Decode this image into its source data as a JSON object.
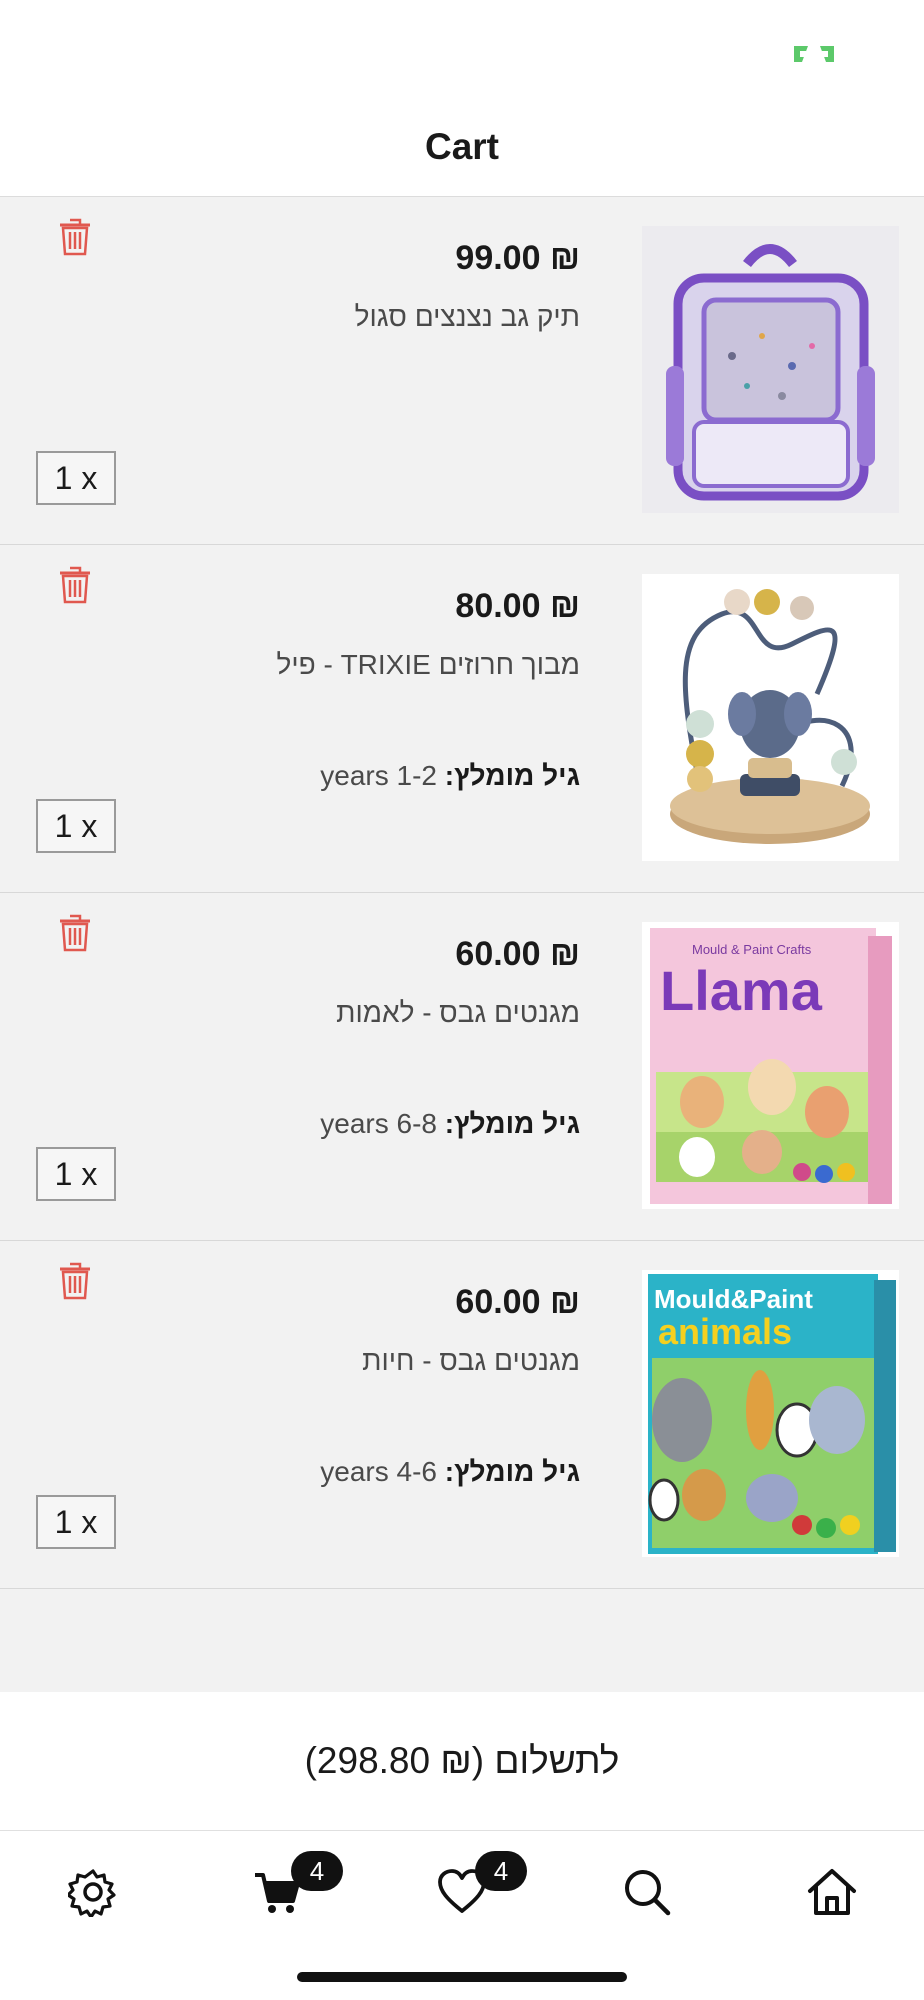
{
  "header": {
    "title": "Cart"
  },
  "cart": {
    "items": [
      {
        "price": "₪ 99.00",
        "name": "תיק גב נצנצים סגול",
        "age_label": "",
        "age_value": "",
        "quantity": "1 x",
        "image_icon": "purple-backpack-image"
      },
      {
        "price": "₪ 80.00",
        "name": "מבוך חרוזים TRIXIE - פיל",
        "age_label": "גיל מומלץ:",
        "age_value": "1-2 years",
        "quantity": "1 x",
        "image_icon": "bead-maze-elephant-image"
      },
      {
        "price": "₪ 60.00",
        "name": "מגנטים גבס - לאמות",
        "age_label": "גיל מומלץ:",
        "age_value": "6-8 years",
        "quantity": "1 x",
        "image_icon": "llama-craft-box-image",
        "image_text": {
          "brand": "Mould & Paint Crafts",
          "title": "Llama"
        }
      },
      {
        "price": "₪ 60.00",
        "name": "מגנטים גבס - חיות",
        "age_label": "גיל מומלץ:",
        "age_value": "4-6 years",
        "quantity": "1 x",
        "image_icon": "animals-craft-box-image",
        "image_text": {
          "line1": "Mould&Paint",
          "line2": "animals"
        }
      }
    ]
  },
  "checkout": {
    "label": "לתשלום (₪ 298.80)"
  },
  "tabbar": {
    "settings_icon": "gear-icon",
    "cart_icon": "cart-icon",
    "cart_badge": "4",
    "wishlist_icon": "heart-icon",
    "wishlist_badge": "4",
    "search_icon": "search-icon",
    "home_icon": "home-icon"
  },
  "colors": {
    "trash": "#e0584f",
    "accent_green": "#5cc96a",
    "badge_bg": "#111111",
    "list_bg": "#f2f2f2"
  }
}
